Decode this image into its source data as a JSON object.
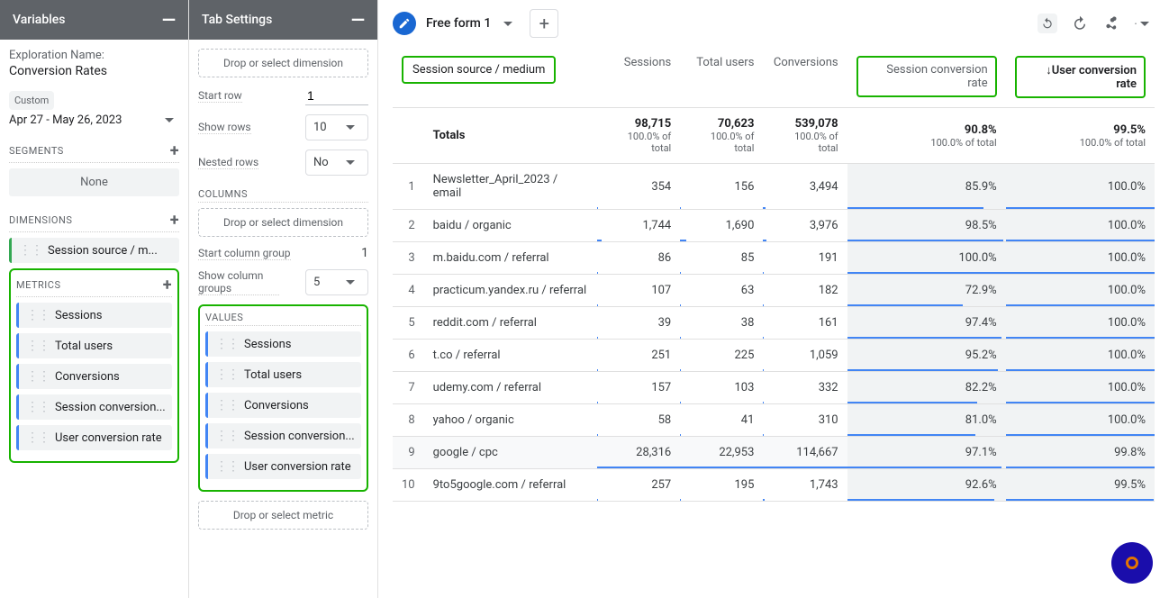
{
  "variables": {
    "header": "Variables",
    "exploration_label": "Exploration Name:",
    "exploration_value": "Conversion Rates",
    "date_preset": "Custom",
    "date_range": "Apr 27 - May 26, 2023",
    "segments_head": "SEGMENTS",
    "segments_none": "None",
    "dimensions_head": "DIMENSIONS",
    "dimension_chip": "Session source / m...",
    "metrics_head": "METRICS",
    "metrics": [
      "Sessions",
      "Total users",
      "Conversions",
      "Session conversion...",
      "User conversion rate"
    ]
  },
  "settings": {
    "header": "Tab Settings",
    "drop_dim": "Drop or select dimension",
    "start_row_label": "Start row",
    "start_row_value": "1",
    "show_rows_label": "Show rows",
    "show_rows_value": "10",
    "nested_label": "Nested rows",
    "nested_value": "No",
    "columns_head": "COLUMNS",
    "drop_dim2": "Drop or select dimension",
    "start_col_label": "Start column group",
    "start_col_value": "1",
    "show_col_label": "Show column groups",
    "show_col_value": "5",
    "values_head": "VALUES",
    "values": [
      "Sessions",
      "Total users",
      "Conversions",
      "Session conversion...",
      "User conversion rate"
    ],
    "drop_metric": "Drop or select metric"
  },
  "toolbar": {
    "tab_name": "Free form 1"
  },
  "table": {
    "dim_header": "Session source / medium",
    "cols": [
      "Sessions",
      "Total users",
      "Conversions",
      "Session conversion rate",
      "↓User conversion rate"
    ],
    "totals_label": "Totals",
    "totals": [
      {
        "v": "98,715",
        "s": "100.0% of total"
      },
      {
        "v": "70,623",
        "s": "100.0% of total"
      },
      {
        "v": "539,078",
        "s": "100.0% of total"
      },
      {
        "v": "90.8%",
        "s": "100.0% of total"
      },
      {
        "v": "99.5%",
        "s": "100.0% of total"
      }
    ],
    "rows": [
      {
        "n": "1",
        "dim": "Newsletter_April_2023 / email",
        "vals": [
          "354",
          "156",
          "3,494",
          "85.9%",
          "100.0%"
        ]
      },
      {
        "n": "2",
        "dim": "baidu / organic",
        "vals": [
          "1,744",
          "1,690",
          "3,976",
          "98.5%",
          "100.0%"
        ]
      },
      {
        "n": "3",
        "dim": "m.baidu.com / referral",
        "vals": [
          "86",
          "85",
          "191",
          "100.0%",
          "100.0%"
        ]
      },
      {
        "n": "4",
        "dim": "practicum.yandex.ru / referral",
        "vals": [
          "107",
          "63",
          "182",
          "72.9%",
          "100.0%"
        ]
      },
      {
        "n": "5",
        "dim": "reddit.com / referral",
        "vals": [
          "39",
          "38",
          "161",
          "97.4%",
          "100.0%"
        ]
      },
      {
        "n": "6",
        "dim": "t.co / referral",
        "vals": [
          "251",
          "225",
          "1,059",
          "95.2%",
          "100.0%"
        ]
      },
      {
        "n": "7",
        "dim": "udemy.com / referral",
        "vals": [
          "157",
          "103",
          "332",
          "82.2%",
          "100.0%"
        ]
      },
      {
        "n": "8",
        "dim": "yahoo / organic",
        "vals": [
          "58",
          "41",
          "310",
          "81.0%",
          "100.0%"
        ]
      },
      {
        "n": "9",
        "dim": "google / cpc",
        "vals": [
          "28,316",
          "22,953",
          "114,667",
          "97.1%",
          "99.8%"
        ],
        "gray": true
      },
      {
        "n": "10",
        "dim": "9to5google.com / referral",
        "vals": [
          "257",
          "195",
          "1,743",
          "92.6%",
          "99.5%"
        ]
      }
    ]
  },
  "chart_data": {
    "type": "table",
    "title": "Free form 1",
    "dimension": "Session source / medium",
    "metrics": [
      "Sessions",
      "Total users",
      "Conversions",
      "Session conversion rate",
      "User conversion rate"
    ],
    "sort": {
      "metric": "User conversion rate",
      "direction": "desc"
    },
    "totals": {
      "Sessions": 98715,
      "Total users": 70623,
      "Conversions": 539078,
      "Session conversion rate": 0.908,
      "User conversion rate": 0.995
    },
    "rows": [
      {
        "Session source / medium": "Newsletter_April_2023 / email",
        "Sessions": 354,
        "Total users": 156,
        "Conversions": 3494,
        "Session conversion rate": 0.859,
        "User conversion rate": 1.0
      },
      {
        "Session source / medium": "baidu / organic",
        "Sessions": 1744,
        "Total users": 1690,
        "Conversions": 3976,
        "Session conversion rate": 0.985,
        "User conversion rate": 1.0
      },
      {
        "Session source / medium": "m.baidu.com / referral",
        "Sessions": 86,
        "Total users": 85,
        "Conversions": 191,
        "Session conversion rate": 1.0,
        "User conversion rate": 1.0
      },
      {
        "Session source / medium": "practicum.yandex.ru / referral",
        "Sessions": 107,
        "Total users": 63,
        "Conversions": 182,
        "Session conversion rate": 0.729,
        "User conversion rate": 1.0
      },
      {
        "Session source / medium": "reddit.com / referral",
        "Sessions": 39,
        "Total users": 38,
        "Conversions": 161,
        "Session conversion rate": 0.974,
        "User conversion rate": 1.0
      },
      {
        "Session source / medium": "t.co / referral",
        "Sessions": 251,
        "Total users": 225,
        "Conversions": 1059,
        "Session conversion rate": 0.952,
        "User conversion rate": 1.0
      },
      {
        "Session source / medium": "udemy.com / referral",
        "Sessions": 157,
        "Total users": 103,
        "Conversions": 332,
        "Session conversion rate": 0.822,
        "User conversion rate": 1.0
      },
      {
        "Session source / medium": "yahoo / organic",
        "Sessions": 58,
        "Total users": 41,
        "Conversions": 310,
        "Session conversion rate": 0.81,
        "User conversion rate": 1.0
      },
      {
        "Session source / medium": "google / cpc",
        "Sessions": 28316,
        "Total users": 22953,
        "Conversions": 114667,
        "Session conversion rate": 0.971,
        "User conversion rate": 0.998
      },
      {
        "Session source / medium": "9to5google.com / referral",
        "Sessions": 257,
        "Total users": 195,
        "Conversions": 1743,
        "Session conversion rate": 0.926,
        "User conversion rate": 0.995
      }
    ]
  }
}
